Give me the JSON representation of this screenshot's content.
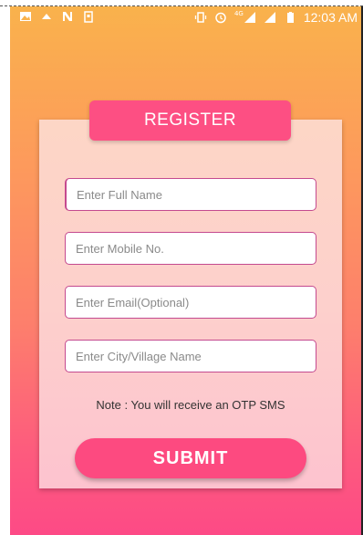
{
  "status_bar": {
    "time": "12:03 AM",
    "network_label": "4G",
    "icons": [
      "image-icon",
      "cloud-icon",
      "n-icon",
      "battery-saver-icon",
      "vibrate-icon",
      "alarm-icon",
      "signal-icon",
      "signal-icon",
      "battery-icon"
    ]
  },
  "form": {
    "title": "REGISTER",
    "fields": [
      {
        "placeholder": "Enter Full Name",
        "value": ""
      },
      {
        "placeholder": "Enter Mobile No.",
        "value": ""
      },
      {
        "placeholder": "Enter Email(Optional)",
        "value": ""
      },
      {
        "placeholder": "Enter City/Village Name",
        "value": ""
      }
    ],
    "note": "Note : You will receive an OTP SMS",
    "submit_label": "SUBMIT"
  },
  "colors": {
    "accent": "#fd4f83",
    "field_border": "#c44a8f",
    "gradient_top": "#f9b24c",
    "gradient_bottom": "#fd4a86"
  }
}
